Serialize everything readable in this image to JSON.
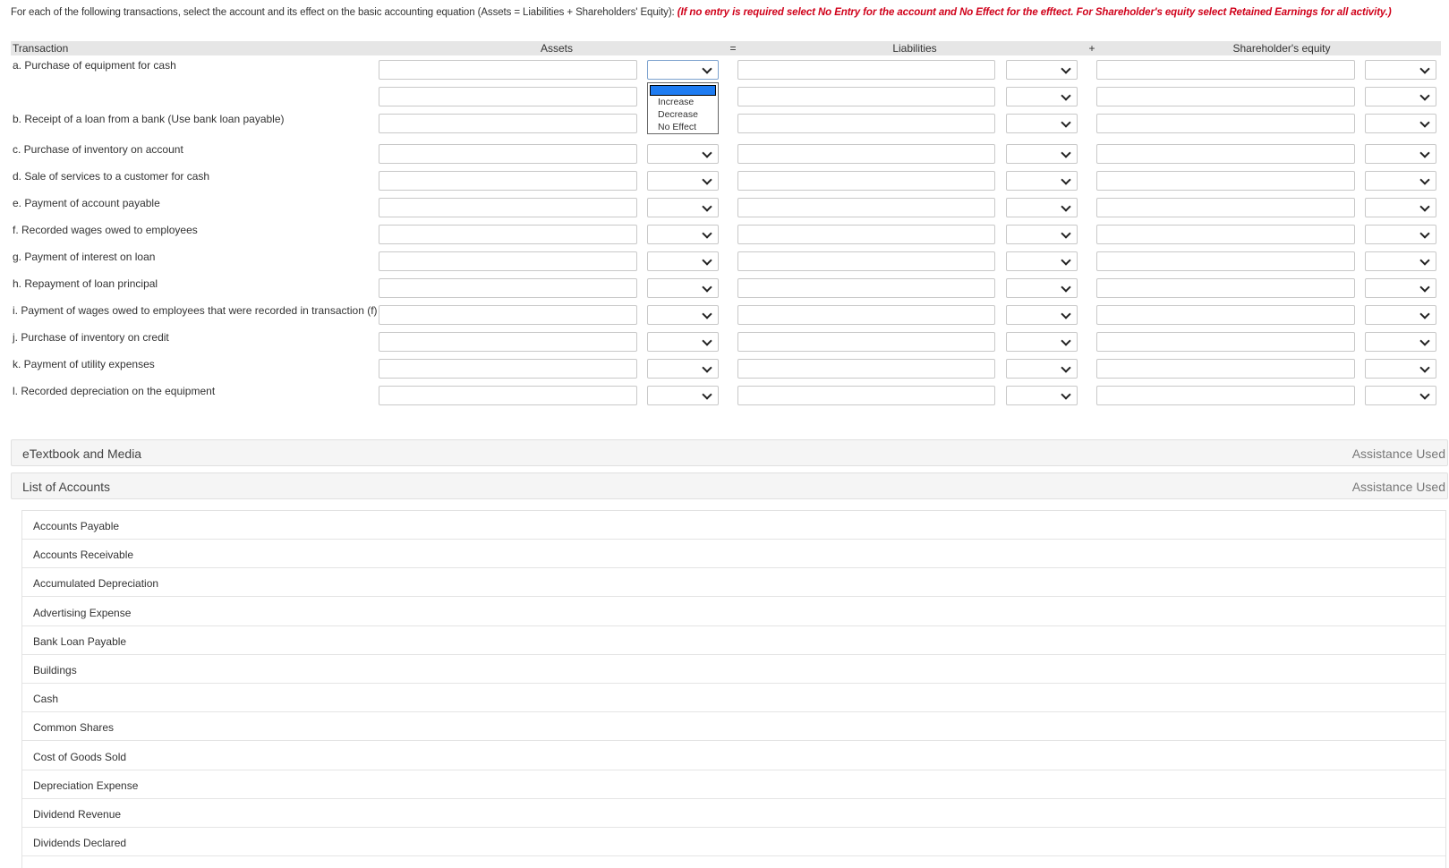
{
  "instructions": {
    "text": "For each of the following transactions, select the account and its effect on the basic accounting equation (Assets = Liabilities + Shareholders' Equity):",
    "note": "(If no entry is required select No Entry for the account and No Effect for the efftect. For Shareholder's equity select Retained Earnings for all activity.)"
  },
  "table": {
    "headers": {
      "transaction": "Transaction",
      "assets": "Assets",
      "equals": "=",
      "liabilities": "Liabilities",
      "plus": "+",
      "equity": "Shareholder's equity"
    },
    "transactions": [
      "a. Purchase of equipment for cash",
      "b. Receipt of a loan from a bank (Use bank loan payable)",
      "c. Purchase of inventory on account",
      "d. Sale of services to a customer for cash",
      "e. Payment of account payable",
      "f. Recorded wages owed to employees",
      "g. Payment of interest on loan",
      "h. Repayment of loan principal",
      "i. Payment of wages owed to employees that were recorded in transaction (f)",
      "j. Purchase of inventory on credit",
      "k. Payment of utility expenses",
      "l. Recorded depreciation on the equipment"
    ]
  },
  "dropdown": {
    "options": [
      "",
      "Increase",
      "Decrease",
      "No Effect"
    ]
  },
  "panels": {
    "etextbook": {
      "title": "eTextbook and Media",
      "status": "Assistance Used"
    },
    "accounts": {
      "title": "List of Accounts",
      "status": "Assistance Used"
    }
  },
  "accounts": [
    "Accounts Payable",
    "Accounts Receivable",
    "Accumulated Depreciation",
    "Advertising Expense",
    "Bank Loan Payable",
    "Buildings",
    "Cash",
    "Common Shares",
    "Cost of Goods Sold",
    "Depreciation Expense",
    "Dividend Revenue",
    "Dividends Declared"
  ]
}
